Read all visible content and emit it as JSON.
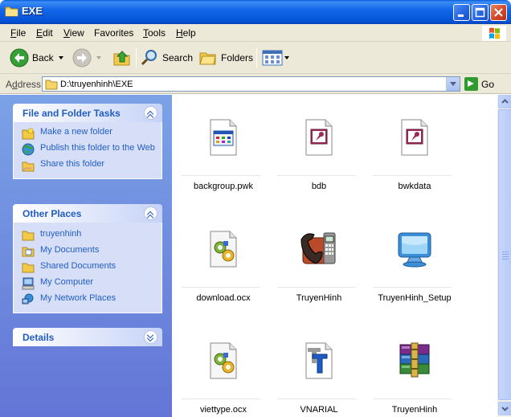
{
  "window": {
    "title": "EXE"
  },
  "menu": {
    "items": [
      {
        "underline": "F",
        "rest": "ile"
      },
      {
        "underline": "E",
        "rest": "dit"
      },
      {
        "underline": "V",
        "rest": "iew"
      },
      {
        "underline": "F",
        "rest": "avorites",
        "prefix": ""
      },
      {
        "underline": "T",
        "rest": "ools"
      },
      {
        "underline": "H",
        "rest": "elp"
      }
    ]
  },
  "toolbar": {
    "back_label": "Back",
    "search_label": "Search",
    "folders_label": "Folders"
  },
  "address": {
    "label_underline": "d",
    "label_prefix": "A",
    "label_rest": "dress",
    "value": "D:\\truyenhinh\\EXE",
    "go_label": "Go"
  },
  "tasks_panel": {
    "title": "File and Folder Tasks",
    "items": [
      {
        "label": "Make a new folder",
        "icon": "new-folder-icon"
      },
      {
        "label": "Publish this folder to the Web",
        "icon": "publish-web-icon"
      },
      {
        "label": "Share this folder",
        "icon": "share-folder-icon"
      }
    ]
  },
  "places_panel": {
    "title": "Other Places",
    "items": [
      {
        "label": "truyenhinh",
        "icon": "folder-icon"
      },
      {
        "label": "My Documents",
        "icon": "my-documents-icon"
      },
      {
        "label": "Shared Documents",
        "icon": "shared-documents-icon"
      },
      {
        "label": "My Computer",
        "icon": "my-computer-icon"
      },
      {
        "label": "My Network Places",
        "icon": "network-places-icon"
      }
    ]
  },
  "details_panel": {
    "title": "Details"
  },
  "files": [
    {
      "name": "backgroup.pwk",
      "icon": "app-window-file-icon"
    },
    {
      "name": "bdb",
      "icon": "access-database-icon"
    },
    {
      "name": "bwkdata",
      "icon": "access-database-icon"
    },
    {
      "name": "download.ocx",
      "icon": "activex-component-icon"
    },
    {
      "name": "TruyenHinh",
      "icon": "phone-fax-icon"
    },
    {
      "name": "TruyenHinh_Setup",
      "icon": "monitor-setup-icon"
    },
    {
      "name": "viettype.ocx",
      "icon": "activex-component-icon"
    },
    {
      "name": "VNARIAL",
      "icon": "truetype-font-icon"
    },
    {
      "name": "TruyenHinh",
      "icon": "winrar-archive-icon"
    }
  ]
}
